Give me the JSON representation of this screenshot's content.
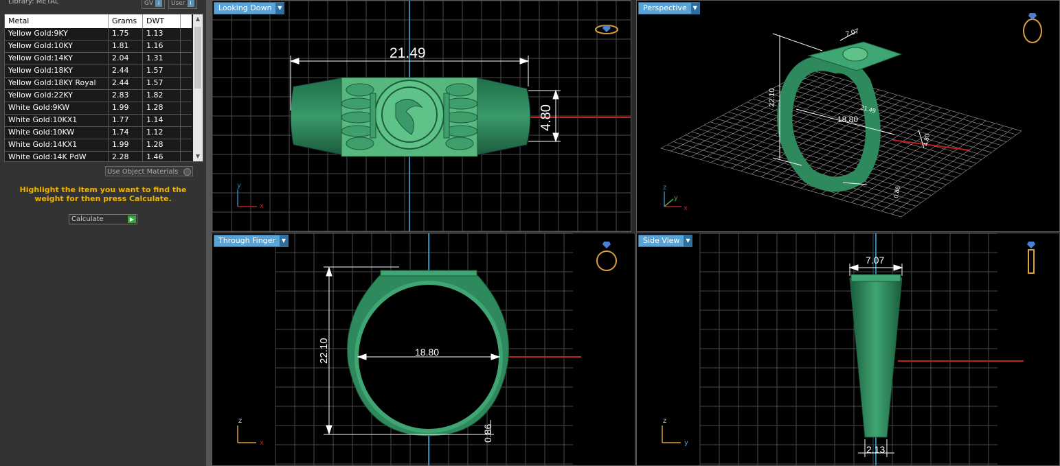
{
  "library": {
    "title": "Library: METAL",
    "btn_gv": "GV",
    "btn_user": "User",
    "info_glyph": "i"
  },
  "table": {
    "headers": [
      "Metal",
      "Grams",
      "DWT"
    ],
    "rows": [
      [
        "Yellow Gold:9KY",
        "1.75",
        "1.13"
      ],
      [
        "Yellow Gold:10KY",
        "1.81",
        "1.16"
      ],
      [
        "Yellow Gold:14KY",
        "2.04",
        "1.31"
      ],
      [
        "Yellow Gold:18KY",
        "2.44",
        "1.57"
      ],
      [
        "Yellow Gold:18KY Royal",
        "2.44",
        "1.57"
      ],
      [
        "Yellow Gold:22KY",
        "2.83",
        "1.82"
      ],
      [
        "White Gold:9KW",
        "1.99",
        "1.28"
      ],
      [
        "White Gold:10KX1",
        "1.77",
        "1.14"
      ],
      [
        "White Gold:10KW",
        "1.74",
        "1.12"
      ],
      [
        "White Gold:14KX1",
        "1.99",
        "1.28"
      ],
      [
        "White Gold:14K PdW",
        "2.28",
        "1.46"
      ]
    ]
  },
  "use_object_materials": "Use Object Materials",
  "hint": "Highlight the item you want to find the weight for then press Calculate.",
  "calculate_label": "Calculate",
  "viewports": {
    "top_left": {
      "label": "Looking Down",
      "dims": {
        "width": "21.49",
        "height": "4.80"
      },
      "axes": {
        "v": "y",
        "h": "x"
      }
    },
    "top_right": {
      "label": "Perspective",
      "dims": {
        "top": "7.07",
        "height": "22.10",
        "inner": "18.80",
        "inner2": "21.49",
        "side": "4.80",
        "bottom": "0.86"
      },
      "axes": {
        "v": "z",
        "h": "x",
        "d": "y"
      }
    },
    "bottom_left": {
      "label": "Through Finger",
      "dims": {
        "height": "22.10",
        "inner": "18.80",
        "shank": "0.86"
      },
      "axes": {
        "v": "z",
        "h": "x"
      }
    },
    "bottom_right": {
      "label": "Side View",
      "dims": {
        "top": "7.07",
        "bottom": "2.13"
      },
      "axes": {
        "v": "z",
        "h": "y"
      }
    }
  },
  "colors": {
    "ring": "#2e8a5c",
    "ring_light": "#6cc98f",
    "grid": "#5a5a5a",
    "axis_red": "#c02020",
    "axis_blue": "#2f88b0",
    "label_bg": "#5aa3d6",
    "hint": "#f0b400"
  }
}
